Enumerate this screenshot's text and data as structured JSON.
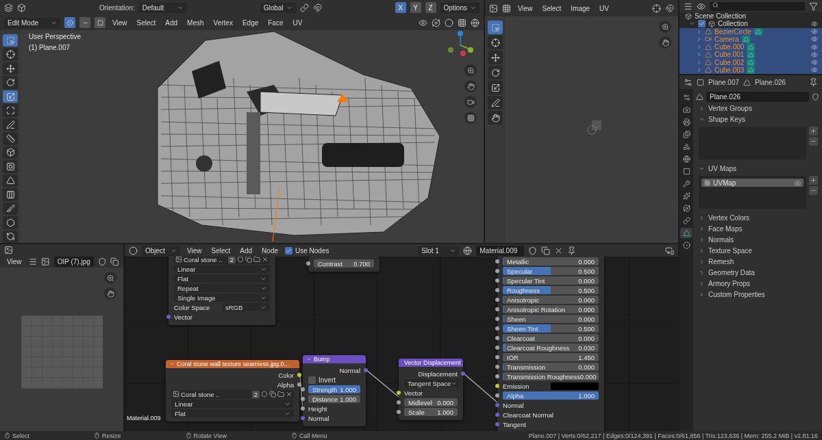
{
  "viewport": {
    "orientation_label": "Orientation:",
    "orientation": "Default",
    "transform": "Global",
    "axes": [
      {
        "label": "X",
        "selected": true
      },
      {
        "label": "Y",
        "selected": false
      },
      {
        "label": "Z",
        "selected": false
      }
    ],
    "options": "Options",
    "mode": "Edit Mode",
    "select_modes": [
      {
        "kind": "vertex",
        "selected": true
      },
      {
        "kind": "edge",
        "selected": false
      },
      {
        "kind": "face",
        "selected": false
      }
    ],
    "menus": [
      "View",
      "Select",
      "Add",
      "Mesh",
      "Vertex",
      "Edge",
      "Face",
      "UV"
    ],
    "overlay": [
      "User Perspective",
      "(1) Plane.007"
    ],
    "tools": [
      {
        "kind": "select",
        "selected": true
      },
      {
        "kind": "cursor",
        "selected": false
      },
      {
        "kind": "move",
        "selected": false
      },
      {
        "kind": "rotate",
        "selected": false
      },
      {
        "kind": "scale",
        "selected": true
      },
      {
        "kind": "transform",
        "selected": false
      },
      {
        "kind": "annotate",
        "selected": false
      },
      {
        "kind": "measure",
        "selected": false
      },
      {
        "kind": "extrude",
        "selected": false
      },
      {
        "kind": "inset",
        "selected": false
      },
      {
        "kind": "bevel",
        "selected": false
      },
      {
        "kind": "loopcut",
        "selected": false
      },
      {
        "kind": "knife",
        "selected": false
      },
      {
        "kind": "polybuild",
        "selected": false
      },
      {
        "kind": "spin",
        "selected": false
      }
    ]
  },
  "uv_editor": {
    "menus": [
      "View",
      "Select",
      "Image",
      "UV"
    ]
  },
  "outliner": {
    "scene": "Scene Collection",
    "collection": {
      "name": "Collection",
      "checked": true
    },
    "items": [
      {
        "name": "BezierCircle",
        "kind": "mesh",
        "selected": true
      },
      {
        "name": "Camera",
        "kind": "camera",
        "selected": true
      },
      {
        "name": "Cube.000",
        "kind": "mesh",
        "selected": true
      },
      {
        "name": "Cube.001",
        "kind": "mesh",
        "selected": true
      },
      {
        "name": "Cube.002",
        "kind": "mesh",
        "selected": true
      },
      {
        "name": "Cube.003",
        "kind": "mesh",
        "selected": true
      }
    ]
  },
  "properties": {
    "object": "Plane.007",
    "data": "Plane.026",
    "datablock": "Plane.026",
    "tabs": [
      {
        "kind": "tool",
        "selected": false
      },
      {
        "kind": "render",
        "selected": false
      },
      {
        "kind": "output",
        "selected": false
      },
      {
        "kind": "view_layer",
        "selected": false
      },
      {
        "kind": "scene",
        "selected": false
      },
      {
        "kind": "world",
        "selected": false
      },
      {
        "kind": "object",
        "selected": false
      },
      {
        "kind": "modifiers",
        "selected": false
      },
      {
        "kind": "particles",
        "selected": false
      },
      {
        "kind": "physics",
        "selected": false
      },
      {
        "kind": "constraints",
        "selected": false
      },
      {
        "kind": "data",
        "selected": true
      },
      {
        "kind": "material",
        "selected": false
      }
    ],
    "panels": [
      {
        "title": "Vertex Groups",
        "expanded": false
      },
      {
        "title": "Shape Keys",
        "expanded": true,
        "kind": "list"
      },
      {
        "title": "UV Maps",
        "expanded": true,
        "kind": "list",
        "items": [
          {
            "name": "UVMap",
            "selected": true
          }
        ]
      },
      {
        "title": "Vertex Colors",
        "expanded": false
      },
      {
        "title": "Face Maps",
        "expanded": false
      },
      {
        "title": "Normals",
        "expanded": false
      },
      {
        "title": "Texture Space",
        "expanded": false
      },
      {
        "title": "Remesh",
        "expanded": false
      },
      {
        "title": "Geometry Data",
        "expanded": false
      },
      {
        "title": "Armory Props",
        "expanded": false
      },
      {
        "title": "Custom Properties",
        "expanded": false
      }
    ]
  },
  "image_editor": {
    "view": "View",
    "image": "OIP (7).jpg"
  },
  "node_editor": {
    "mode": "Object",
    "menus": [
      "View",
      "Select",
      "Add",
      "Node"
    ],
    "use_nodes": {
      "label": "Use Nodes",
      "checked": true
    },
    "slot": "Slot 1",
    "material": "Material.009",
    "frame_label": "Material.009",
    "nodes": [
      {
        "kind": "partial",
        "rows": [
          {
            "kind": "image",
            "label": "Coral stone ..",
            "value": "2"
          },
          {
            "kind": "dropdown",
            "label": "Linear"
          },
          {
            "kind": "dropdown",
            "label": "Flat"
          },
          {
            "kind": "dropdown",
            "label": "Repeat"
          },
          {
            "kind": "dropdown",
            "label": "Single Image"
          },
          {
            "kind": "labeled_dropdown",
            "label": "Color Space",
            "value": "sRGB"
          },
          {
            "kind": "input",
            "label": "Vector",
            "color": "#6363c7"
          }
        ]
      },
      {
        "kind": "partial",
        "rows": [
          {
            "kind": "field",
            "label": "Contrast",
            "value": "0.700",
            "color": "#a1a1a1"
          }
        ]
      },
      {
        "kind": "partial",
        "rows": [
          {
            "kind": "slider",
            "label": "Metallic",
            "value": "0.000",
            "level": 0,
            "color": "#a1a1a1"
          },
          {
            "kind": "slider",
            "label": "Specular",
            "value": "0.500",
            "level": 0.5,
            "color": "#a1a1a1"
          },
          {
            "kind": "slider",
            "label": "Specular Tint",
            "value": "0.000",
            "level": 0,
            "color": "#a1a1a1"
          },
          {
            "kind": "slider",
            "label": "Roughness",
            "value": "0.500",
            "level": 0.5,
            "color": "#a1a1a1"
          },
          {
            "kind": "slider",
            "label": "Anisotropic",
            "value": "0.000",
            "level": 0,
            "color": "#a1a1a1"
          },
          {
            "kind": "slider",
            "label": "Anisotropic Rotation",
            "value": "0.000",
            "level": 0,
            "color": "#a1a1a1"
          },
          {
            "kind": "slider",
            "label": "Sheen",
            "value": "0.000",
            "level": 0,
            "color": "#a1a1a1"
          },
          {
            "kind": "slider",
            "label": "Sheen Tint",
            "value": "0.500",
            "level": 0.5,
            "color": "#a1a1a1"
          },
          {
            "kind": "slider",
            "label": "Clearcoat",
            "value": "0.000",
            "level": 0,
            "color": "#a1a1a1"
          },
          {
            "kind": "slider",
            "label": "Clearcoat Roughness",
            "value": "0.030",
            "level": 0.03,
            "color": "#a1a1a1"
          },
          {
            "kind": "field",
            "label": "IOR",
            "value": "1.450",
            "color": "#a1a1a1"
          },
          {
            "kind": "slider",
            "label": "Transmission",
            "value": "0.000",
            "level": 0,
            "color": "#a1a1a1"
          },
          {
            "kind": "slider",
            "label": "Transmission Roughness",
            "value": "0.000",
            "level": 0,
            "color": "#a1a1a1"
          },
          {
            "kind": "color",
            "label": "Emission",
            "color": "#c7c729"
          },
          {
            "kind": "slider",
            "label": "Alpha",
            "value": "1.000",
            "level": 1,
            "color": "#a1a1a1"
          },
          {
            "kind": "input",
            "label": "Normal",
            "color": "#6363c7"
          },
          {
            "kind": "input",
            "label": "Clearcoat Normal",
            "color": "#6363c7"
          },
          {
            "kind": "input",
            "label": "Tangent",
            "color": "#6363c7"
          }
        ]
      },
      {
        "kind": "texture",
        "title": "Coral stone wall texture seamless.jpg.0...",
        "rows": [
          {
            "kind": "output",
            "label": "Color",
            "color": "#c7c729"
          },
          {
            "kind": "output",
            "label": "Alpha",
            "color": "#a1a1a1"
          },
          {
            "kind": "image",
            "label": "Coral stone ..",
            "value": "2"
          },
          {
            "kind": "dropdown",
            "label": "Linear"
          },
          {
            "kind": "dropdown",
            "label": "Flat"
          }
        ]
      },
      {
        "kind": "vector",
        "title": "Bump",
        "rows": [
          {
            "kind": "output",
            "label": "Normal",
            "color": "#6363c7"
          },
          {
            "kind": "checkbox",
            "label": "Invert",
            "checked": false
          },
          {
            "kind": "slider",
            "label": "Strength",
            "value": "1.000",
            "level": 1,
            "color": "#a1a1a1"
          },
          {
            "kind": "field",
            "label": "Distance",
            "value": "1.000",
            "color": "#a1a1a1"
          },
          {
            "kind": "input",
            "label": "Height",
            "color": "#a1a1a1"
          },
          {
            "kind": "input",
            "label": "Normal",
            "color": "#6363c7"
          }
        ]
      },
      {
        "kind": "vector",
        "title": "Vector Displacement",
        "rows": [
          {
            "kind": "output",
            "label": "Displacement",
            "color": "#6363c7"
          },
          {
            "kind": "dropdown",
            "label": "Tangent Space"
          },
          {
            "kind": "input",
            "label": "Vector",
            "color": "#c7c729"
          },
          {
            "kind": "field",
            "label": "Midlevel",
            "value": "0.000",
            "color": "#a1a1a1"
          },
          {
            "kind": "field",
            "label": "Scale",
            "value": "1.000",
            "color": "#a1a1a1"
          }
        ]
      }
    ]
  },
  "status_bar": {
    "hints": [
      "Select",
      "Resize",
      "Rotate View",
      "Call Menu"
    ],
    "stats": "Plane.007 | Verts:0/62,217 | Edges:0/124,391 | Faces:0/61,856 | Tris:123,636 | Mem: 255.2 MiB | v2.81.16"
  }
}
